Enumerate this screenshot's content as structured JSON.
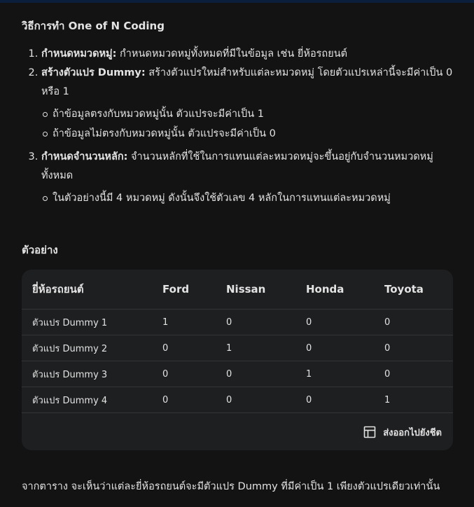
{
  "heading": "วิธีการทำ One of N Coding",
  "steps": [
    {
      "number": "1.",
      "title": "กำหนดหมวดหมู่:",
      "text": " กำหนดหมวดหมู่ทั้งหมดที่มีในข้อมูล เช่น ยี่ห้อรถยนต์"
    },
    {
      "number": "2.",
      "title": "สร้างตัวแปร Dummy:",
      "text": " สร้างตัวแปรใหม่สำหรับแต่ละหมวดหมู่ โดยตัวแปรเหล่านี้จะมีค่าเป็น 0 หรือ 1",
      "bullets": [
        "ถ้าข้อมูลตรงกับหมวดหมู่นั้น ตัวแปรจะมีค่าเป็น 1",
        "ถ้าข้อมูลไม่ตรงกับหมวดหมู่นั้น ตัวแปรจะมีค่าเป็น 0"
      ]
    },
    {
      "number": "3.",
      "title": "กำหนดจำนวนหลัก:",
      "text": " จำนวนหลักที่ใช้ในการแทนแต่ละหมวดหมู่จะขึ้นอยู่กับจำนวนหมวดหมู่ทั้งหมด",
      "bullets": [
        "ในตัวอย่างนี้มี 4 หมวดหมู่ ดังนั้นจึงใช้ตัวเลข 4 หลักในการแทนแต่ละหมวดหมู่"
      ]
    }
  ],
  "example_heading": "ตัวอย่าง",
  "table": {
    "headers": [
      "ยี่ห้อรถยนต์",
      "Ford",
      "Nissan",
      "Honda",
      "Toyota"
    ],
    "rows": [
      [
        "ตัวแปร Dummy 1",
        "1",
        "0",
        "0",
        "0"
      ],
      [
        "ตัวแปร Dummy 2",
        "0",
        "1",
        "0",
        "0"
      ],
      [
        "ตัวแปร Dummy 3",
        "0",
        "0",
        "1",
        "0"
      ],
      [
        "ตัวแปร Dummy 4",
        "0",
        "0",
        "0",
        "1"
      ]
    ],
    "export_label": "ส่งออกไปยังชีต",
    "export_icon": "table-grid-icon"
  },
  "summary": "จากตาราง จะเห็นว่าแต่ละยี่ห้อรถยนต์จะมีตัวแปร Dummy ที่มีค่าเป็น 1 เพียงตัวแปรเดียวเท่านั้น",
  "colors": {
    "background": "#131314",
    "card": "#1e1f20",
    "text": "#e3e3e3",
    "divider": "#333537"
  }
}
